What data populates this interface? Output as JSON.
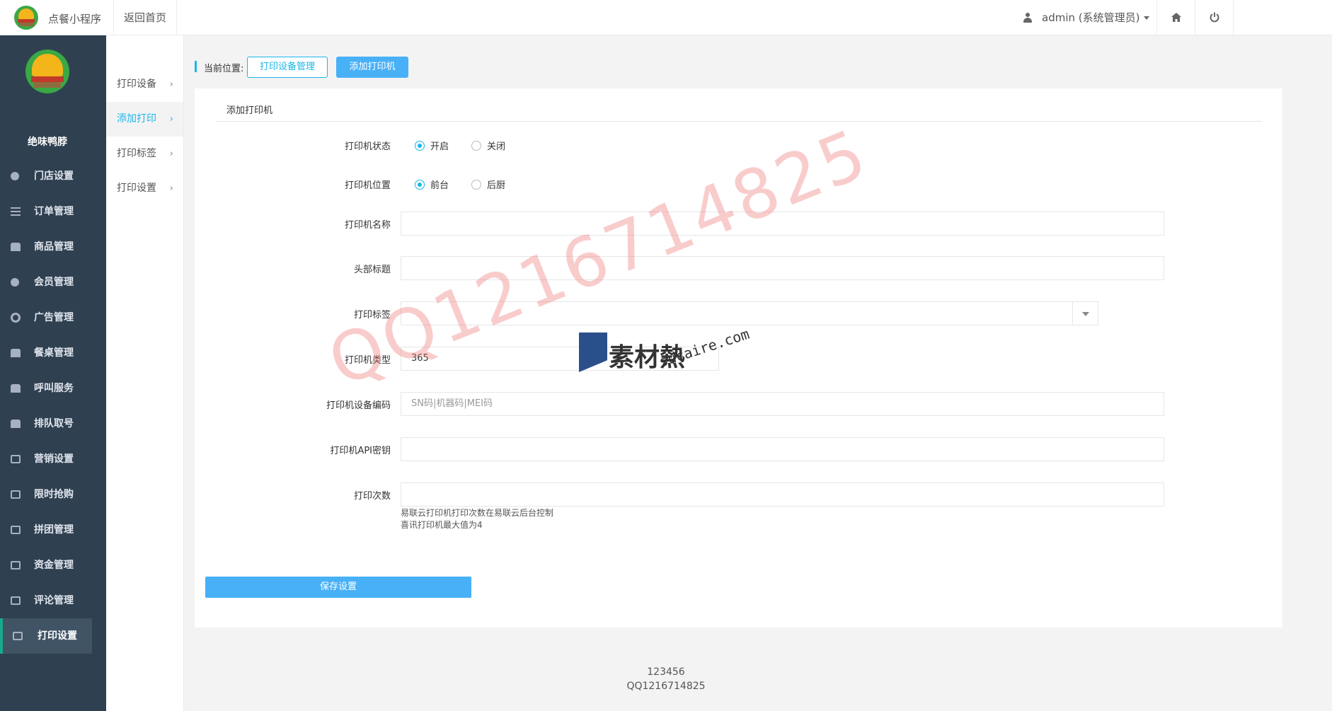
{
  "header": {
    "app_title": "点餐小程序",
    "home_link": "返回首页",
    "user_label": "admin (系统管理员)"
  },
  "sidebar": {
    "store_name": "绝味鸭脖",
    "items": [
      {
        "label": "门店设置",
        "icon": "key-icon"
      },
      {
        "label": "订单管理",
        "icon": "list-icon"
      },
      {
        "label": "商品管理",
        "icon": "trophy-icon"
      },
      {
        "label": "会员管理",
        "icon": "user-icon"
      },
      {
        "label": "广告管理",
        "icon": "life-ring-icon"
      },
      {
        "label": "餐桌管理",
        "icon": "binoculars-icon"
      },
      {
        "label": "呼叫服务",
        "icon": "cloud-icon"
      },
      {
        "label": "排队取号",
        "icon": "cloud-icon"
      },
      {
        "label": "营销设置",
        "icon": "gift-icon"
      },
      {
        "label": "限时抢购",
        "icon": "copy-icon"
      },
      {
        "label": "拼团管理",
        "icon": "copy-icon"
      },
      {
        "label": "资金管理",
        "icon": "book-icon"
      },
      {
        "label": "评论管理",
        "icon": "money-icon"
      },
      {
        "label": "打印设置",
        "icon": "copy-icon",
        "active": true
      }
    ]
  },
  "subnav": {
    "items": [
      {
        "label": "打印设备"
      },
      {
        "label": "添加打印",
        "active": true
      },
      {
        "label": "打印标签"
      },
      {
        "label": "打印设置"
      }
    ]
  },
  "breadcrumb": {
    "label": "当前位置:",
    "button1": "打印设备管理",
    "button2": "添加打印机"
  },
  "form": {
    "title": "添加打印机",
    "status_label": "打印机状态",
    "status_options": [
      "开启",
      "关闭"
    ],
    "status_selected": "开启",
    "position_label": "打印机位置",
    "position_options": [
      "前台",
      "后厨"
    ],
    "position_selected": "前台",
    "name_label": "打印机名称",
    "name_value": "",
    "header_label": "头部标题",
    "header_value": "",
    "tag_label": "打印标签",
    "tag_value": "",
    "type_label": "打印机类型",
    "type_value": "365",
    "code_label": "打印机设备编码",
    "code_placeholder": "SN码|机器码|MEI码",
    "apikey_label": "打印机API密钥",
    "apikey_value": "",
    "count_label": "打印次数",
    "count_value": "",
    "help_line1": "易联云打印机打印次数在易联云后台控制",
    "help_line2": "喜讯打印机最大值为4",
    "save_label": "保存设置"
  },
  "footer": {
    "line1": "123456",
    "line2": "QQ1216714825"
  },
  "watermark": {
    "text": "QQ1216714825",
    "logo_text": "素材熱",
    "url": "sucaire.com"
  },
  "colors": {
    "sidebar_bg": "#2f4050",
    "accent": "#1ab7ea",
    "button_blue": "#48b0f7",
    "active_nav_border": "#19aa8d"
  }
}
